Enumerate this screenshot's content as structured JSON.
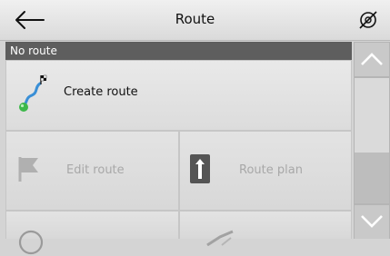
{
  "header": {
    "title": "Route",
    "back_icon": "arrow-left-icon",
    "status_icon": "no-location-icon"
  },
  "section": {
    "label": "No route"
  },
  "create": {
    "label": "Create route",
    "icon": "route-flag-icon"
  },
  "tiles": [
    {
      "label": "Edit route",
      "icon": "flag-icon"
    },
    {
      "label": "Route plan",
      "icon": "route-plan-icon"
    }
  ],
  "scrollbar": {
    "up_icon": "chevron-up-icon",
    "down_icon": "chevron-down-icon"
  }
}
